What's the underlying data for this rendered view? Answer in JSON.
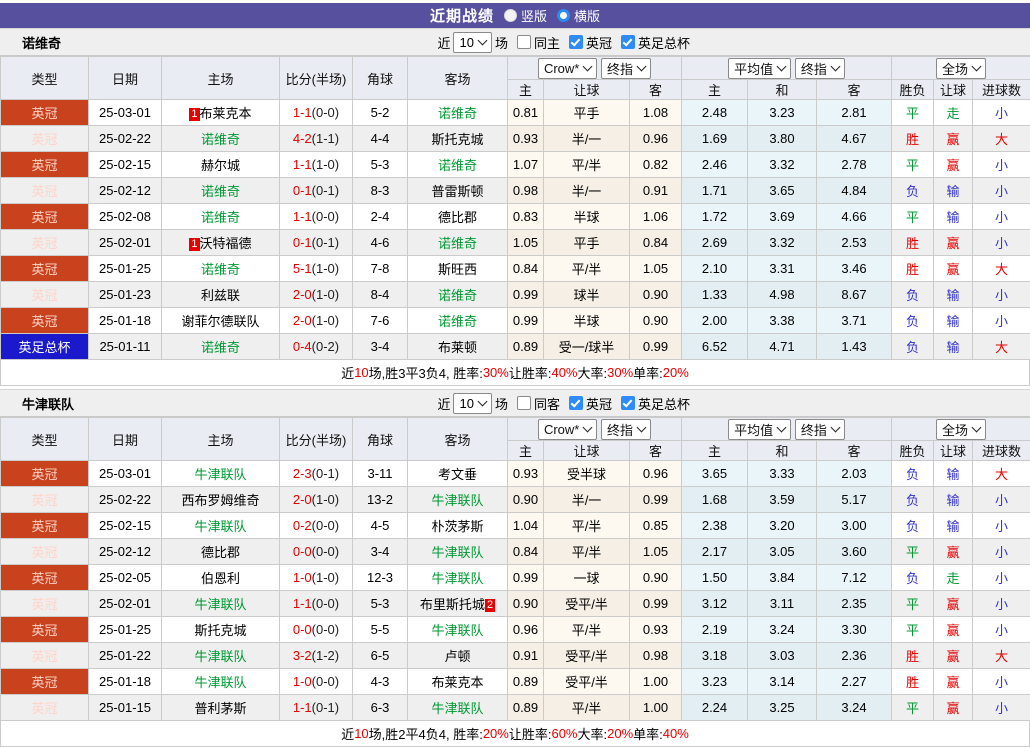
{
  "colors": {
    "accent_purple": "#57509f",
    "league_red": "#c8431d",
    "cup_blue": "#1a1acc",
    "team_green": "#009933",
    "score_red": "#e60000",
    "lose_blue": "#3333cc",
    "checkbox_blue": "#2e8bf7"
  },
  "header": {
    "title": "近期战绩",
    "radio_vertical": "竖版",
    "radio_horizontal": "横版"
  },
  "columns": {
    "type": "类型",
    "date": "日期",
    "home": "主场",
    "score": "比分(半场)",
    "corner": "角球",
    "away": "客场",
    "dropdowns": {
      "crow": "Crow*",
      "final1": "终指",
      "avg": "平均值",
      "final2": "终指",
      "scope": "全场"
    },
    "sub": [
      "主",
      "让球",
      "客",
      "主",
      "和",
      "客",
      "胜负",
      "让球",
      "进球数"
    ]
  },
  "tables": [
    {
      "team": "诺维奇",
      "filter": {
        "near": "近",
        "count": "10",
        "games": "场",
        "same": "同主",
        "leagues": [
          "英冠",
          "英足总杯"
        ]
      },
      "rows": [
        {
          "type": "英冠",
          "cup": false,
          "date": "25-03-01",
          "home": "布莱克本",
          "home_self": false,
          "home_badge": "1",
          "ft": "1-1",
          "ht": "(0-0)",
          "corner": "5-2",
          "away": "诺维奇",
          "away_self": true,
          "away_badge": null,
          "crow": [
            "0.81",
            "平手",
            "1.08"
          ],
          "avg": [
            "2.48",
            "3.23",
            "2.81"
          ],
          "res": [
            [
              "平",
              "g"
            ],
            [
              "走",
              "g"
            ],
            [
              "小",
              "b"
            ]
          ]
        },
        {
          "type": "英冠",
          "cup": false,
          "date": "25-02-22",
          "home": "诺维奇",
          "home_self": true,
          "home_badge": null,
          "ft": "4-2",
          "ht": "(1-1)",
          "corner": "4-4",
          "away": "斯托克城",
          "away_self": false,
          "away_badge": null,
          "crow": [
            "0.93",
            "半/一",
            "0.96"
          ],
          "avg": [
            "1.69",
            "3.80",
            "4.67"
          ],
          "res": [
            [
              "胜",
              "r"
            ],
            [
              "赢",
              "r"
            ],
            [
              "大",
              "r"
            ]
          ]
        },
        {
          "type": "英冠",
          "cup": false,
          "date": "25-02-15",
          "home": "赫尔城",
          "home_self": false,
          "home_badge": null,
          "ft": "1-1",
          "ht": "(1-0)",
          "corner": "5-3",
          "away": "诺维奇",
          "away_self": true,
          "away_badge": null,
          "crow": [
            "1.07",
            "平/半",
            "0.82"
          ],
          "avg": [
            "2.46",
            "3.32",
            "2.78"
          ],
          "res": [
            [
              "平",
              "g"
            ],
            [
              "赢",
              "r"
            ],
            [
              "小",
              "b"
            ]
          ]
        },
        {
          "type": "英冠",
          "cup": false,
          "date": "25-02-12",
          "home": "诺维奇",
          "home_self": true,
          "home_badge": null,
          "ft": "0-1",
          "ht": "(0-1)",
          "corner": "8-3",
          "away": "普雷斯顿",
          "away_self": false,
          "away_badge": null,
          "crow": [
            "0.98",
            "半/一",
            "0.91"
          ],
          "avg": [
            "1.71",
            "3.65",
            "4.84"
          ],
          "res": [
            [
              "负",
              "b"
            ],
            [
              "输",
              "b"
            ],
            [
              "小",
              "b"
            ]
          ]
        },
        {
          "type": "英冠",
          "cup": false,
          "date": "25-02-08",
          "home": "诺维奇",
          "home_self": true,
          "home_badge": null,
          "ft": "1-1",
          "ht": "(0-0)",
          "corner": "2-4",
          "away": "德比郡",
          "away_self": false,
          "away_badge": null,
          "crow": [
            "0.83",
            "半球",
            "1.06"
          ],
          "avg": [
            "1.72",
            "3.69",
            "4.66"
          ],
          "res": [
            [
              "平",
              "g"
            ],
            [
              "输",
              "b"
            ],
            [
              "小",
              "b"
            ]
          ]
        },
        {
          "type": "英冠",
          "cup": false,
          "date": "25-02-01",
          "home": "沃特福德",
          "home_self": false,
          "home_badge": "1",
          "ft": "0-1",
          "ht": "(0-1)",
          "corner": "4-6",
          "away": "诺维奇",
          "away_self": true,
          "away_badge": null,
          "crow": [
            "1.05",
            "平手",
            "0.84"
          ],
          "avg": [
            "2.69",
            "3.32",
            "2.53"
          ],
          "res": [
            [
              "胜",
              "r"
            ],
            [
              "赢",
              "r"
            ],
            [
              "小",
              "b"
            ]
          ]
        },
        {
          "type": "英冠",
          "cup": false,
          "date": "25-01-25",
          "home": "诺维奇",
          "home_self": true,
          "home_badge": null,
          "ft": "5-1",
          "ht": "(1-0)",
          "corner": "7-8",
          "away": "斯旺西",
          "away_self": false,
          "away_badge": null,
          "crow": [
            "0.84",
            "平/半",
            "1.05"
          ],
          "avg": [
            "2.10",
            "3.31",
            "3.46"
          ],
          "res": [
            [
              "胜",
              "r"
            ],
            [
              "赢",
              "r"
            ],
            [
              "大",
              "r"
            ]
          ]
        },
        {
          "type": "英冠",
          "cup": false,
          "date": "25-01-23",
          "home": "利兹联",
          "home_self": false,
          "home_badge": null,
          "ft": "2-0",
          "ht": "(1-0)",
          "corner": "8-4",
          "away": "诺维奇",
          "away_self": true,
          "away_badge": null,
          "crow": [
            "0.99",
            "球半",
            "0.90"
          ],
          "avg": [
            "1.33",
            "4.98",
            "8.67"
          ],
          "res": [
            [
              "负",
              "b"
            ],
            [
              "输",
              "b"
            ],
            [
              "小",
              "b"
            ]
          ]
        },
        {
          "type": "英冠",
          "cup": false,
          "date": "25-01-18",
          "home": "谢菲尔德联队",
          "home_self": false,
          "home_badge": null,
          "ft": "2-0",
          "ht": "(1-0)",
          "corner": "7-6",
          "away": "诺维奇",
          "away_self": true,
          "away_badge": null,
          "crow": [
            "0.99",
            "半球",
            "0.90"
          ],
          "avg": [
            "2.00",
            "3.38",
            "3.71"
          ],
          "res": [
            [
              "负",
              "b"
            ],
            [
              "输",
              "b"
            ],
            [
              "小",
              "b"
            ]
          ]
        },
        {
          "type": "英足总杯",
          "cup": true,
          "date": "25-01-11",
          "home": "诺维奇",
          "home_self": true,
          "home_badge": null,
          "ft": "0-4",
          "ht": "(0-2)",
          "corner": "3-4",
          "away": "布莱顿",
          "away_self": false,
          "away_badge": null,
          "crow": [
            "0.89",
            "受一/球半",
            "0.99"
          ],
          "avg": [
            "6.52",
            "4.71",
            "1.43"
          ],
          "res": [
            [
              "负",
              "b"
            ],
            [
              "输",
              "b"
            ],
            [
              "大",
              "r"
            ]
          ]
        }
      ],
      "summary": [
        [
          "近",
          false
        ],
        [
          "10",
          true
        ],
        [
          "场,胜3平3负4, 胜率:",
          false
        ],
        [
          "30%",
          true
        ],
        [
          " 让胜率:",
          false
        ],
        [
          "40%",
          true
        ],
        [
          " 大率:",
          false
        ],
        [
          "30%",
          true
        ],
        [
          " 单率:",
          false
        ],
        [
          "20%",
          true
        ]
      ]
    },
    {
      "team": "牛津联队",
      "filter": {
        "near": "近",
        "count": "10",
        "games": "场",
        "same": "同客",
        "leagues": [
          "英冠",
          "英足总杯"
        ]
      },
      "rows": [
        {
          "type": "英冠",
          "cup": false,
          "date": "25-03-01",
          "home": "牛津联队",
          "home_self": true,
          "home_badge": null,
          "ft": "2-3",
          "ht": "(0-1)",
          "corner": "3-11",
          "away": "考文垂",
          "away_self": false,
          "away_badge": null,
          "crow": [
            "0.93",
            "受半球",
            "0.96"
          ],
          "avg": [
            "3.65",
            "3.33",
            "2.03"
          ],
          "res": [
            [
              "负",
              "b"
            ],
            [
              "输",
              "b"
            ],
            [
              "大",
              "r"
            ]
          ]
        },
        {
          "type": "英冠",
          "cup": false,
          "date": "25-02-22",
          "home": "西布罗姆维奇",
          "home_self": false,
          "home_badge": null,
          "ft": "2-0",
          "ht": "(1-0)",
          "corner": "13-2",
          "away": "牛津联队",
          "away_self": true,
          "away_badge": null,
          "crow": [
            "0.90",
            "半/一",
            "0.99"
          ],
          "avg": [
            "1.68",
            "3.59",
            "5.17"
          ],
          "res": [
            [
              "负",
              "b"
            ],
            [
              "输",
              "b"
            ],
            [
              "小",
              "b"
            ]
          ]
        },
        {
          "type": "英冠",
          "cup": false,
          "date": "25-02-15",
          "home": "牛津联队",
          "home_self": true,
          "home_badge": null,
          "ft": "0-2",
          "ht": "(0-0)",
          "corner": "4-5",
          "away": "朴茨茅斯",
          "away_self": false,
          "away_badge": null,
          "crow": [
            "1.04",
            "平/半",
            "0.85"
          ],
          "avg": [
            "2.38",
            "3.20",
            "3.00"
          ],
          "res": [
            [
              "负",
              "b"
            ],
            [
              "输",
              "b"
            ],
            [
              "小",
              "b"
            ]
          ]
        },
        {
          "type": "英冠",
          "cup": false,
          "date": "25-02-12",
          "home": "德比郡",
          "home_self": false,
          "home_badge": null,
          "ft": "0-0",
          "ht": "(0-0)",
          "corner": "3-4",
          "away": "牛津联队",
          "away_self": true,
          "away_badge": null,
          "crow": [
            "0.84",
            "平/半",
            "1.05"
          ],
          "avg": [
            "2.17",
            "3.05",
            "3.60"
          ],
          "res": [
            [
              "平",
              "g"
            ],
            [
              "赢",
              "r"
            ],
            [
              "小",
              "b"
            ]
          ]
        },
        {
          "type": "英冠",
          "cup": false,
          "date": "25-02-05",
          "home": "伯恩利",
          "home_self": false,
          "home_badge": null,
          "ft": "1-0",
          "ht": "(1-0)",
          "corner": "12-3",
          "away": "牛津联队",
          "away_self": true,
          "away_badge": null,
          "crow": [
            "0.99",
            "一球",
            "0.90"
          ],
          "avg": [
            "1.50",
            "3.84",
            "7.12"
          ],
          "res": [
            [
              "负",
              "b"
            ],
            [
              "走",
              "g"
            ],
            [
              "小",
              "b"
            ]
          ]
        },
        {
          "type": "英冠",
          "cup": false,
          "date": "25-02-01",
          "home": "牛津联队",
          "home_self": true,
          "home_badge": null,
          "ft": "1-1",
          "ht": "(0-0)",
          "corner": "5-3",
          "away": "布里斯托城",
          "away_self": false,
          "away_badge": "2",
          "crow": [
            "0.90",
            "受平/半",
            "0.99"
          ],
          "avg": [
            "3.12",
            "3.11",
            "2.35"
          ],
          "res": [
            [
              "平",
              "g"
            ],
            [
              "赢",
              "r"
            ],
            [
              "小",
              "b"
            ]
          ]
        },
        {
          "type": "英冠",
          "cup": false,
          "date": "25-01-25",
          "home": "斯托克城",
          "home_self": false,
          "home_badge": null,
          "ft": "0-0",
          "ht": "(0-0)",
          "corner": "5-5",
          "away": "牛津联队",
          "away_self": true,
          "away_badge": null,
          "crow": [
            "0.96",
            "平/半",
            "0.93"
          ],
          "avg": [
            "2.19",
            "3.24",
            "3.30"
          ],
          "res": [
            [
              "平",
              "g"
            ],
            [
              "赢",
              "r"
            ],
            [
              "小",
              "b"
            ]
          ]
        },
        {
          "type": "英冠",
          "cup": false,
          "date": "25-01-22",
          "home": "牛津联队",
          "home_self": true,
          "home_badge": null,
          "ft": "3-2",
          "ht": "(1-2)",
          "corner": "6-5",
          "away": "卢顿",
          "away_self": false,
          "away_badge": null,
          "crow": [
            "0.91",
            "受平/半",
            "0.98"
          ],
          "avg": [
            "3.18",
            "3.03",
            "2.36"
          ],
          "res": [
            [
              "胜",
              "r"
            ],
            [
              "赢",
              "r"
            ],
            [
              "大",
              "r"
            ]
          ]
        },
        {
          "type": "英冠",
          "cup": false,
          "date": "25-01-18",
          "home": "牛津联队",
          "home_self": true,
          "home_badge": null,
          "ft": "1-0",
          "ht": "(0-0)",
          "corner": "4-3",
          "away": "布莱克本",
          "away_self": false,
          "away_badge": null,
          "crow": [
            "0.89",
            "受平/半",
            "1.00"
          ],
          "avg": [
            "3.23",
            "3.14",
            "2.27"
          ],
          "res": [
            [
              "胜",
              "r"
            ],
            [
              "赢",
              "r"
            ],
            [
              "小",
              "b"
            ]
          ]
        },
        {
          "type": "英冠",
          "cup": false,
          "date": "25-01-15",
          "home": "普利茅斯",
          "home_self": false,
          "home_badge": null,
          "ft": "1-1",
          "ht": "(0-1)",
          "corner": "6-3",
          "away": "牛津联队",
          "away_self": true,
          "away_badge": null,
          "crow": [
            "0.89",
            "平/半",
            "1.00"
          ],
          "avg": [
            "2.24",
            "3.25",
            "3.24"
          ],
          "res": [
            [
              "平",
              "g"
            ],
            [
              "赢",
              "r"
            ],
            [
              "小",
              "b"
            ]
          ]
        }
      ],
      "summary": [
        [
          "近",
          false
        ],
        [
          "10",
          true
        ],
        [
          "场,胜2平4负4, 胜率:",
          false
        ],
        [
          "20%",
          true
        ],
        [
          " 让胜率:",
          false
        ],
        [
          "60%",
          true
        ],
        [
          " 大率:",
          false
        ],
        [
          "20%",
          true
        ],
        [
          " 单率:",
          false
        ],
        [
          "40%",
          true
        ]
      ]
    }
  ]
}
